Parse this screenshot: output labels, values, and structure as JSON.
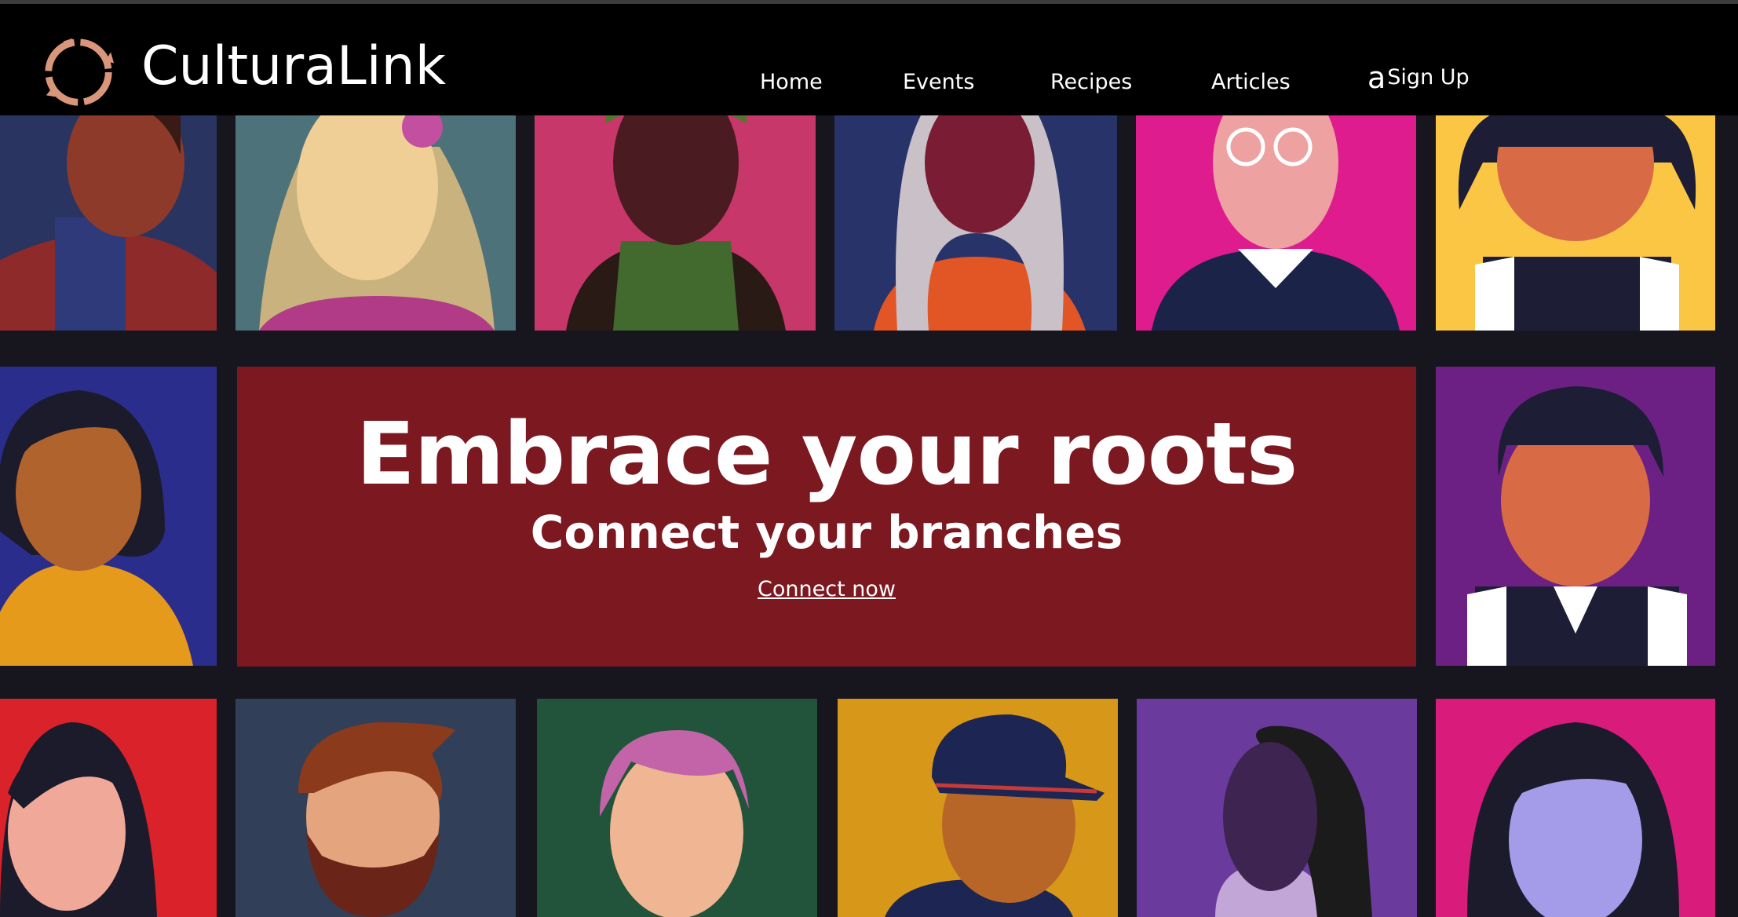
{
  "brand": {
    "name": "CulturaLink",
    "logo_icon": "circular-arrows-icon",
    "logo_color": "#d9967a"
  },
  "nav": {
    "home": "Home",
    "events": "Events",
    "recipes": "Recipes",
    "articles": "Articles",
    "signup_icon_glyph": "a",
    "signup": "Sign Up"
  },
  "hero": {
    "title": "Embrace your roots",
    "subtitle": "Connect your branches",
    "cta": "Connect now",
    "background": "#7b1820"
  },
  "colors": {
    "page_background": "#17161f",
    "navbar_background": "#000000"
  }
}
